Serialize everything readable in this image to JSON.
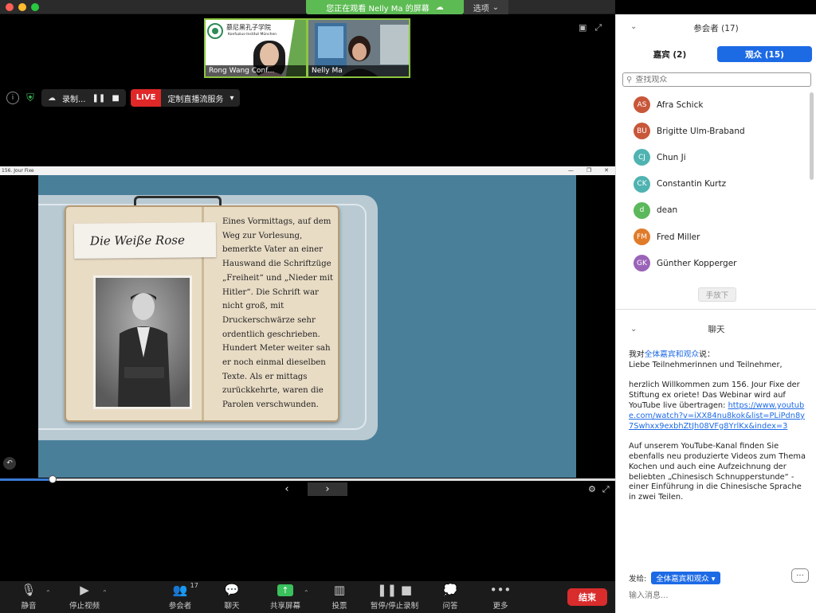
{
  "titlebar": {
    "share_banner": "您正在观看 Nelly Ma 的屏幕",
    "options_label": "选项"
  },
  "video_tiles": [
    {
      "name": "Rong Wang Conf...",
      "logo_cn": "慕尼黑孔子学院",
      "logo_de": "Konfuzius-Institut München"
    },
    {
      "name": "Nelly Ma"
    }
  ],
  "rec_bar": {
    "recording_label": "录制...",
    "live_label": "LIVE",
    "stream_label": "定制直播流服务"
  },
  "shared_window": {
    "title": "156. Jour Fixe",
    "slide_title": "Die Weiße Rose",
    "slide_text": "Eines Vormittags, auf dem Weg zur Vorlesung, bemerkte Vater an einer Hauswand die Schriftzüge „Freiheit“ und „Nieder mit Hitler“. Die Schrift war nicht groß, mit Druckerschwärze sehr ordentlich geschrieben. Hundert Meter weiter sah er noch einmal dieselben Texte. Als er mittags zurückkehrte, waren die Parolen verschwunden.",
    "progress_fraction": 0.085
  },
  "toolbar": {
    "mute": "静音",
    "stop_video": "停止视频",
    "participants": "参会者",
    "participants_count": "17",
    "chat": "聊天",
    "share_screen": "共享屏幕",
    "poll": "投票",
    "pause_record": "暂停/停止录制",
    "qa": "问答",
    "more": "更多",
    "end": "结束"
  },
  "panel": {
    "title": "参会者 (17)",
    "tab_panelists": "嘉宾 (2)",
    "tab_attendees": "观众 (15)",
    "search_placeholder": "查找观众",
    "attendees": [
      {
        "initials": "AS",
        "name": "Afra Schick",
        "color": "#c8573a"
      },
      {
        "initials": "BU",
        "name": "Brigitte Ulm-Braband",
        "color": "#c8573a"
      },
      {
        "initials": "CJ",
        "name": "Chun Ji",
        "color": "#4fb3b1"
      },
      {
        "initials": "CK",
        "name": "Constantin Kurtz",
        "color": "#4fb3b1"
      },
      {
        "initials": "d",
        "name": "dean",
        "color": "#5cb85c"
      },
      {
        "initials": "FM",
        "name": "Fred Miller",
        "color": "#e07b2a"
      },
      {
        "initials": "GK",
        "name": "Günther Kopperger",
        "color": "#9a63b8"
      }
    ],
    "lower_hand": "手放下",
    "chat_title": "聊天",
    "chat": {
      "from_prefix": "我对",
      "to": "全体嘉宾和观众",
      "from_suffix": "说：",
      "line1": "Liebe Teilnehmerinnen und Teilnehmer,",
      "line2": "herzlich Willkommen zum 156. Jour Fixe der Stiftung ex oriete! Das Webinar wird auf YouTube live übertragen: ",
      "link": "https://www.youtube.com/watch?v=iXX84nu8kok&list=PLiPdn8y7Swhxx9exbhZtJh08VFg8YrlKx&index=3",
      "line3": "Auf unserem YouTube-Kanal finden Sie ebenfalls neu produzierte Videos zum Thema Kochen und auch eine Aufzeichnung der beliebten „Chinesisch Schnupperstunde“ - einer Einführung in die Chinesische Sprache in zwei Teilen."
    },
    "send_to_label": "发给:",
    "send_to_value": "全体嘉宾和观众 ▾",
    "input_placeholder": "输入消息..."
  }
}
